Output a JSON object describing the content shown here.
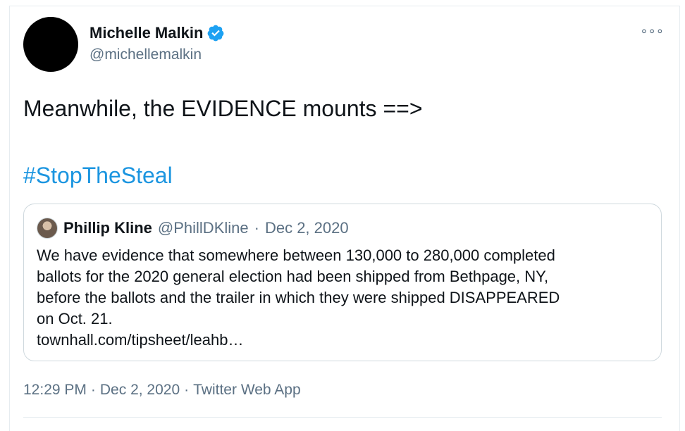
{
  "author": {
    "display_name": "Michelle Malkin",
    "handle": "@michellemalkin",
    "verified_icon": "verified-badge-icon"
  },
  "more_menu": "∘∘∘",
  "tweet": {
    "text": "Meanwhile, the EVIDENCE mounts ==>",
    "hashtag": "#StopTheSteal"
  },
  "quote": {
    "display_name": "Phillip Kline",
    "handle": "@PhillDKline",
    "separator": "·",
    "date": "Dec 2, 2020",
    "lines": [
      "We have evidence that somewhere between 130,000 to 280,000 completed",
      "ballots for the 2020 general election had been shipped from Bethpage, NY,",
      "before the ballots and the trailer in which they were shipped DISAPPEARED",
      "on Oct. 21."
    ],
    "link": "townhall.com/tipsheet/leahb…"
  },
  "meta": {
    "time": "12:29 PM",
    "separator": "·",
    "date": "Dec 2, 2020",
    "source": "Twitter Web App"
  },
  "colors": {
    "link_blue": "#1b95e0",
    "verified_blue": "#1da1f2",
    "secondary_text": "#5b7083",
    "border": "#cfd9de"
  }
}
